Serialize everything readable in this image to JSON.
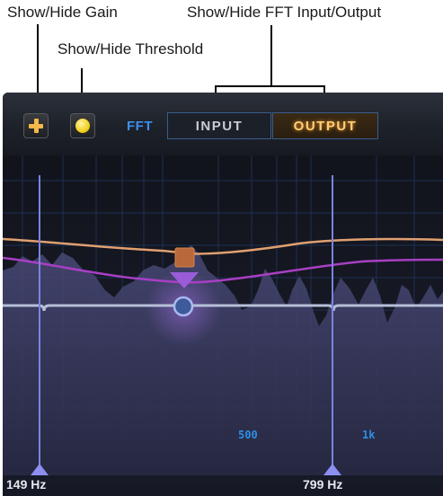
{
  "callouts": {
    "show_hide_gain": "Show/Hide Gain",
    "show_hide_fft": "Show/Hide FFT Input/Output",
    "show_hide_threshold": "Show/Hide Threshold"
  },
  "toolbar": {
    "fft_label": "FFT",
    "input_label": "INPUT",
    "output_label": "OUTPUT",
    "output_active": true
  },
  "graph": {
    "freq_labels": [
      "500",
      "1k"
    ],
    "band_low_label": "149 Hz",
    "band_high_label": "799 Hz"
  },
  "colors": {
    "gain_curve": "#e0a070",
    "threshold_curve": "#a83fc4",
    "detector_line": "#b5bfd8",
    "accent_blue": "#3d8ff0",
    "output_active": "#ffcf78",
    "gain_handle": "#b8683a",
    "band_marker": "#8c8ff0"
  }
}
